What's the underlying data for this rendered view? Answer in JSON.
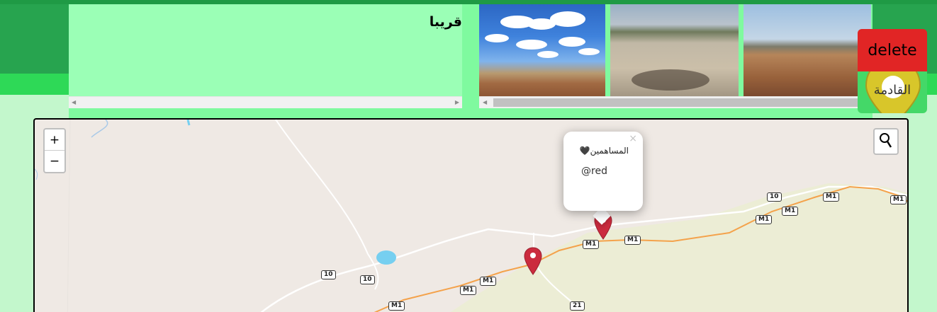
{
  "info": {
    "status_text": "قريبا"
  },
  "photos": [
    {
      "name": "photo-sky-field"
    },
    {
      "name": "photo-dry-riverbed"
    },
    {
      "name": "photo-dry-plain"
    }
  ],
  "actions": {
    "delete_label": "delete",
    "next_label": "القادمة"
  },
  "map": {
    "zoom_in": "+",
    "zoom_out": "−",
    "search_icon": "magnifier-icon",
    "popup": {
      "title": "المساهمين🖤",
      "handle": "@red",
      "close": "×"
    },
    "road_labels": [
      {
        "id": "r1",
        "text": "10"
      },
      {
        "id": "r2",
        "text": "M1"
      },
      {
        "id": "r3",
        "text": "M1"
      },
      {
        "id": "r4",
        "text": "M1"
      },
      {
        "id": "r5",
        "text": "M1"
      },
      {
        "id": "r6",
        "text": "M1"
      },
      {
        "id": "r7",
        "text": "M1"
      },
      {
        "id": "r8",
        "text": "10"
      },
      {
        "id": "r9",
        "text": "10"
      },
      {
        "id": "r10",
        "text": "M1"
      },
      {
        "id": "r11",
        "text": "M1"
      },
      {
        "id": "r12",
        "text": "M1"
      },
      {
        "id": "r13",
        "text": "21"
      }
    ],
    "colors": {
      "land": "#efe9e4",
      "lowland": "#ecedd5",
      "highway": "#f4a24b",
      "marker": "#cb2b3e",
      "water": "#76cff0"
    }
  }
}
